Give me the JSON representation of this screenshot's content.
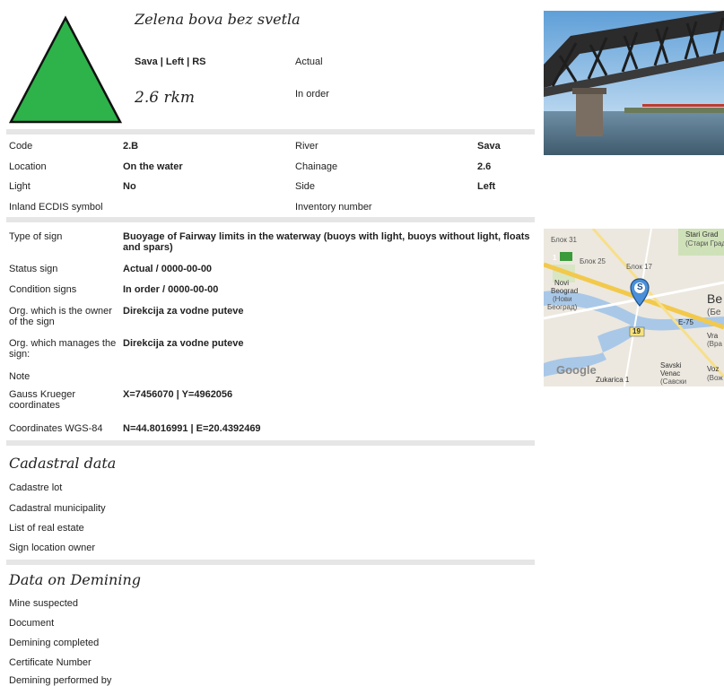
{
  "sign": {
    "title": "Zelena bova bez svetla",
    "location_line": "Sava | Left | RS",
    "status": "Actual",
    "rkm": "2.6 rkm",
    "condition": "In order",
    "symbol_color": "#2db34a"
  },
  "details": {
    "rows": [
      {
        "l1": "Code",
        "v1": "2.B",
        "l2": "River",
        "v2": "Sava"
      },
      {
        "l1": "Location",
        "v1": "On the water",
        "l2": "Chainage",
        "v2": "2.6"
      },
      {
        "l1": "Light",
        "v1": "No",
        "l2": "Side",
        "v2": "Left"
      },
      {
        "l1": "Inland ECDIS symbol",
        "v1": "",
        "l2": "Inventory number",
        "v2": ""
      }
    ]
  },
  "attributes": [
    {
      "label": "Type of sign",
      "value": "Buoyage of Fairway limits in the waterway (buoys with light, buoys without light, floats and spars)"
    },
    {
      "label": "Status sign",
      "value": "Actual / 0000-00-00"
    },
    {
      "label": "Condition signs",
      "value": "In order / 0000-00-00"
    },
    {
      "label": "Org. which is the owner of the sign",
      "value": "Direkcija za vodne puteve"
    },
    {
      "label": "Org. which manages the sign:",
      "value": "Direkcija za vodne puteve"
    },
    {
      "label": "Note",
      "value": ""
    },
    {
      "label": "Gauss Krueger coordinates",
      "value": "X=7456070 | Y=4962056"
    },
    {
      "label": "Coordinates WGS-84",
      "value": "N=44.8016991 | E=20.4392469"
    }
  ],
  "cadastral": {
    "title": "Cadastral data",
    "items": [
      "Cadastre lot",
      "Cadastral municipality",
      "List of real estate",
      "Sign location owner"
    ]
  },
  "demining": {
    "title": "Data on Demining",
    "items": [
      "Mine suspected",
      "Document",
      "Demining completed",
      "Certificate Number",
      "Demining performed by"
    ]
  },
  "map": {
    "marker_letter": "S",
    "labels": [
      "Блок 31",
      "Stari Grad",
      "(Стари Град)",
      "Блок 25",
      "Блок 17",
      "Novi",
      "Beograd",
      "(Нови",
      "Београд)",
      "Be",
      "(Бе",
      "19",
      "E-75",
      "Vra",
      "(Вра",
      "Savski",
      "Venac",
      "(Савски",
      "Voz",
      "(Вож",
      "Google",
      "Zukarica 1"
    ],
    "road_badge": "1"
  }
}
